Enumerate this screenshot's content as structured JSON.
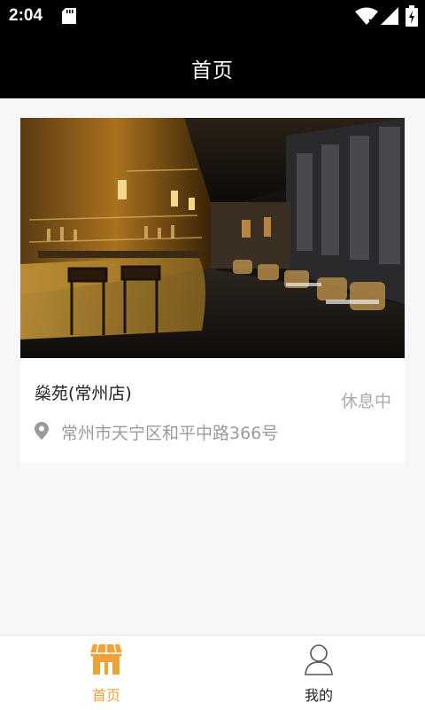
{
  "status_bar": {
    "time": "2:04",
    "icons": [
      "sd-card-icon",
      "wifi-icon",
      "signal-icon",
      "battery-icon"
    ]
  },
  "header": {
    "title": "首页"
  },
  "store": {
    "name": "燊苑(常州店)",
    "status": "休息中",
    "address": "常州市天宁区和平中路366号",
    "image_icon": "restaurant-photo"
  },
  "nav": {
    "items": [
      {
        "label": "首页",
        "icon": "storefront-icon",
        "active": true
      },
      {
        "label": "我的",
        "icon": "person-icon",
        "active": false
      }
    ]
  },
  "colors": {
    "accent": "#f0a23a",
    "header_bg": "#000000",
    "page_bg": "#f7f6f9"
  }
}
